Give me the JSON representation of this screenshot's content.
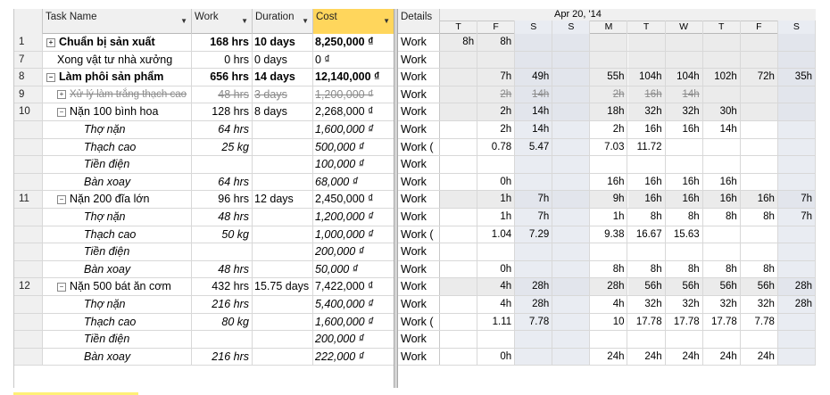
{
  "headers": {
    "task_name": "Task Name",
    "work": "Work",
    "duration": "Duration",
    "cost": "Cost",
    "details": "Details",
    "week_label": "Apr 20, '14",
    "days": [
      "T",
      "F",
      "S",
      "S",
      "M",
      "T",
      "W",
      "T",
      "F",
      "S"
    ]
  },
  "rows": [
    {
      "id": "1",
      "name": "Chuẩn bị sản xuất",
      "work": "168 hrs",
      "duration": "10 days",
      "cost": "8,250,000 ₫",
      "details": "Work",
      "style": "summary",
      "toggle": "+",
      "indent": 0,
      "days": [
        "8h",
        "8h",
        "",
        "",
        "",
        "",
        "",
        "",
        "",
        ""
      ]
    },
    {
      "id": "7",
      "name": "Xong vật tư nhà xưởng",
      "work": "0 hrs",
      "duration": "0 days",
      "cost": "0 ₫",
      "details": "Work",
      "style": "normal",
      "toggle": "",
      "indent": 1,
      "days": [
        "",
        "",
        "",
        "",
        "",
        "",
        "",
        "",
        "",
        ""
      ]
    },
    {
      "id": "8",
      "name": "Làm phôi sản phẩm",
      "work": "656 hrs",
      "duration": "14 days",
      "cost": "12,140,000 ₫",
      "details": "Work",
      "style": "summary",
      "toggle": "−",
      "indent": 0,
      "days": [
        "",
        "7h",
        "49h",
        "",
        "55h",
        "104h",
        "104h",
        "102h",
        "72h",
        "35h"
      ]
    },
    {
      "id": "9",
      "name": "Xử lý làm trắng thạch cao",
      "work": "48 hrs",
      "duration": "3 days",
      "cost": "1,200,000 ₫",
      "details": "Work",
      "style": "struck",
      "toggle": "+",
      "indent": 1,
      "days": [
        "",
        "2h",
        "14h",
        "",
        "2h",
        "16h",
        "14h",
        "",
        "",
        ""
      ]
    },
    {
      "id": "10",
      "name": "Nặn 100 bình hoa",
      "work": "128 hrs",
      "duration": "8 days",
      "cost": "2,268,000 ₫",
      "details": "Work",
      "style": "normal",
      "toggle": "−",
      "indent": 1,
      "days": [
        "",
        "2h",
        "14h",
        "",
        "18h",
        "32h",
        "32h",
        "30h",
        "",
        ""
      ]
    },
    {
      "id": "",
      "name": "Thợ nặn",
      "work": "64 hrs",
      "duration": "",
      "cost": "1,600,000 ₫",
      "details": "Work",
      "style": "assign",
      "toggle": "",
      "indent": 2,
      "days": [
        "",
        "2h",
        "14h",
        "",
        "2h",
        "16h",
        "16h",
        "14h",
        "",
        ""
      ]
    },
    {
      "id": "",
      "name": "Thạch cao",
      "work": "25 kg",
      "duration": "",
      "cost": "500,000 ₫",
      "details": "Work (",
      "style": "assign",
      "toggle": "",
      "indent": 2,
      "days": [
        "",
        "0.78",
        "5.47",
        "",
        "7.03",
        "11.72",
        "",
        "",
        "",
        ""
      ]
    },
    {
      "id": "",
      "name": "Tiền điện",
      "work": "",
      "duration": "",
      "cost": "100,000 ₫",
      "details": "Work",
      "style": "assign",
      "toggle": "",
      "indent": 2,
      "days": [
        "",
        "",
        "",
        "",
        "",
        "",
        "",
        "",
        "",
        ""
      ]
    },
    {
      "id": "",
      "name": "Bàn xoay",
      "work": "64 hrs",
      "duration": "",
      "cost": "68,000 ₫",
      "details": "Work",
      "style": "assign",
      "toggle": "",
      "indent": 2,
      "days": [
        "",
        "0h",
        "",
        "",
        "16h",
        "16h",
        "16h",
        "16h",
        "",
        ""
      ]
    },
    {
      "id": "11",
      "name": "Nặn 200 đĩa lớn",
      "work": "96 hrs",
      "duration": "12 days",
      "cost": "2,450,000 ₫",
      "details": "Work",
      "style": "normal",
      "toggle": "−",
      "indent": 1,
      "days": [
        "",
        "1h",
        "7h",
        "",
        "9h",
        "16h",
        "16h",
        "16h",
        "16h",
        "7h"
      ]
    },
    {
      "id": "",
      "name": "Thợ nặn",
      "work": "48 hrs",
      "duration": "",
      "cost": "1,200,000 ₫",
      "details": "Work",
      "style": "assign",
      "toggle": "",
      "indent": 2,
      "days": [
        "",
        "1h",
        "7h",
        "",
        "1h",
        "8h",
        "8h",
        "8h",
        "8h",
        "7h"
      ]
    },
    {
      "id": "",
      "name": "Thạch cao",
      "work": "50 kg",
      "duration": "",
      "cost": "1,000,000 ₫",
      "details": "Work (",
      "style": "assign",
      "toggle": "",
      "indent": 2,
      "days": [
        "",
        "1.04",
        "7.29",
        "",
        "9.38",
        "16.67",
        "15.63",
        "",
        "",
        ""
      ]
    },
    {
      "id": "",
      "name": "Tiền điện",
      "work": "",
      "duration": "",
      "cost": "200,000 ₫",
      "details": "Work",
      "style": "assign",
      "toggle": "",
      "indent": 2,
      "days": [
        "",
        "",
        "",
        "",
        "",
        "",
        "",
        "",
        "",
        ""
      ]
    },
    {
      "id": "",
      "name": "Bàn xoay",
      "work": "48 hrs",
      "duration": "",
      "cost": "50,000 ₫",
      "details": "Work",
      "style": "assign",
      "toggle": "",
      "indent": 2,
      "days": [
        "",
        "0h",
        "",
        "",
        "8h",
        "8h",
        "8h",
        "8h",
        "8h",
        ""
      ]
    },
    {
      "id": "12",
      "name": "Nặn 500 bát ăn cơm",
      "work": "432 hrs",
      "duration": "15.75 days",
      "cost": "7,422,000 ₫",
      "details": "Work",
      "style": "normal",
      "toggle": "−",
      "indent": 1,
      "days": [
        "",
        "4h",
        "28h",
        "",
        "28h",
        "56h",
        "56h",
        "56h",
        "56h",
        "28h"
      ]
    },
    {
      "id": "",
      "name": "Thợ nặn",
      "work": "216 hrs",
      "duration": "",
      "cost": "5,400,000 ₫",
      "details": "Work",
      "style": "assign",
      "toggle": "",
      "indent": 2,
      "days": [
        "",
        "4h",
        "28h",
        "",
        "4h",
        "32h",
        "32h",
        "32h",
        "32h",
        "28h"
      ]
    },
    {
      "id": "",
      "name": "Thạch cao",
      "work": "80 kg",
      "duration": "",
      "cost": "1,600,000 ₫",
      "details": "Work (",
      "style": "assign",
      "toggle": "",
      "indent": 2,
      "days": [
        "",
        "1.11",
        "7.78",
        "",
        "10",
        "17.78",
        "17.78",
        "17.78",
        "7.78",
        ""
      ]
    },
    {
      "id": "",
      "name": "Tiền điện",
      "work": "",
      "duration": "",
      "cost": "200,000 ₫",
      "details": "Work",
      "style": "assign",
      "toggle": "",
      "indent": 2,
      "days": [
        "",
        "",
        "",
        "",
        "",
        "",
        "",
        "",
        "",
        ""
      ]
    },
    {
      "id": "",
      "name": "Bàn xoay",
      "work": "216 hrs",
      "duration": "",
      "cost": "222,000 ₫",
      "details": "Work",
      "style": "assign",
      "toggle": "",
      "indent": 2,
      "days": [
        "",
        "0h",
        "",
        "",
        "24h",
        "24h",
        "24h",
        "24h",
        "24h",
        ""
      ]
    }
  ]
}
